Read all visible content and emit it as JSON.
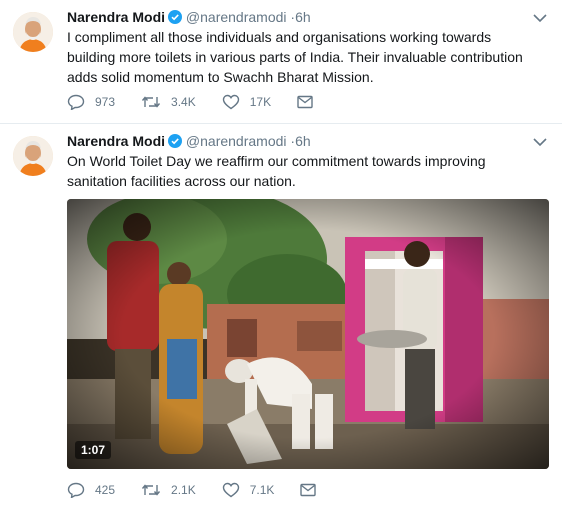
{
  "colors": {
    "text": "#14171a",
    "muted": "#657786",
    "verified": "#1da1f2",
    "divider": "#e6ecf0"
  },
  "tweets": [
    {
      "name": "Narendra Modi",
      "handle": "@narendramodi",
      "dot": "·",
      "time": "6h",
      "text": "I compliment all those individuals and organisations working towards building more toilets in various parts of India. Their invaluable contribution adds solid momentum to Swachh Bharat Mission.",
      "replies": "973",
      "retweets": "3.4K",
      "likes": "17K"
    },
    {
      "name": "Narendra Modi",
      "handle": "@narendramodi",
      "dot": "·",
      "time": "6h",
      "text": "On World Toilet Day we reaffirm our commitment towards improving sanitation facilities across our nation.",
      "video_duration": "1:07",
      "replies": "425",
      "retweets": "2.1K",
      "likes": "7.1K"
    }
  ],
  "icons": {
    "verified": "verified-badge-icon",
    "caret": "chevron-down-icon",
    "reply": "reply-icon",
    "retweet": "retweet-icon",
    "like": "heart-icon",
    "dm": "envelope-icon"
  }
}
